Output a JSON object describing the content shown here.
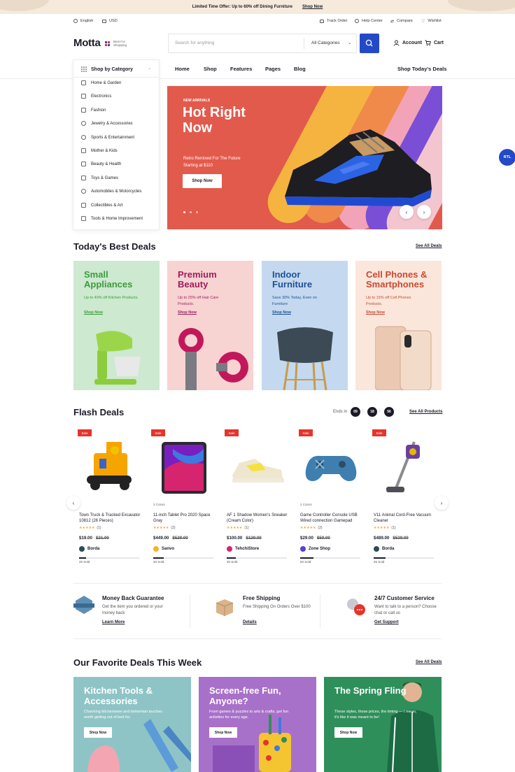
{
  "topbar": {
    "text": "Limited Time Offer: Up to 60% off Dining Furniture",
    "link": "Shop Now"
  },
  "utility": {
    "language": "English",
    "currency": "USD",
    "track": "Track Order",
    "help": "Help Center",
    "compare": "Compare",
    "wishlist": "Wishlist"
  },
  "header": {
    "logo": "Motta",
    "tagline": "Best For Shopping",
    "search_placeholder": "Search for anything",
    "category_select": "All Categories",
    "account": "Account",
    "cart": "Cart"
  },
  "nav": {
    "shop_by_category": "Shop by Category",
    "items": [
      "Home",
      "Shop",
      "Features",
      "Pages",
      "Blog"
    ],
    "right": "Shop Today's Deals"
  },
  "categories": [
    "Home & Garden",
    "Electronics",
    "Fashion",
    "Jewelry & Accessories",
    "Sports & Entertainment",
    "Mother & Kids",
    "Beauty & Health",
    "Toys & Games",
    "Automobiles & Motorcycles",
    "Collectibles & Art",
    "Tools & Home Improvement"
  ],
  "hero": {
    "kicker": "NEW ARRIVALS",
    "title": "Hot Right Now",
    "subtitle": "Retro Remixed For The Future Starting at $110",
    "button": "Shop Now",
    "rtl": "RTL"
  },
  "best_deals": {
    "title": "Today's Best Deals",
    "see_all": "See All Deals",
    "cards": [
      {
        "title": "Small Appliances",
        "desc": "Up to 40% off Kitchen Products.",
        "link": "Shop Now",
        "bg": "#cde9cf",
        "title_color": "#3d9a3e"
      },
      {
        "title": "Premium Beauty",
        "desc": "Up to 25% off Hair Care Products.",
        "link": "Shop Now",
        "bg": "#f7d3d1",
        "title_color": "#9d1d5d"
      },
      {
        "title": "Indoor Furniture",
        "desc": "Save 30% Today, Even on Furniture",
        "link": "Shop Now",
        "bg": "#c4d9ef",
        "title_color": "#1e4f98"
      },
      {
        "title": "Cell Phones & Smartphones",
        "desc": "Up to 15% off Cell Phones Products.",
        "link": "Shop Now",
        "bg": "#fbe6dc",
        "title_color": "#c9492f"
      }
    ]
  },
  "flash": {
    "title": "Flash Deals",
    "ends_in": "Ends in",
    "timer": [
      "09",
      "18",
      "56"
    ],
    "see_all": "See All Products",
    "sale_label": "Sale",
    "products": [
      {
        "colors": "",
        "name": "Town Truck & Tracked Excavator 10812 (26 Pieces)",
        "stars": "★★★★★",
        "reviews": "(1)",
        "price": "$19.00",
        "old": "$21.00",
        "store": "Borda",
        "store_color": "#2c4b56",
        "sold": "20 Sold",
        "sold_ratio": 0.12
      },
      {
        "colors": "3 Colors",
        "name": "11-inch Tablet Pro 2020 Space Gray",
        "stars": "★★★★★",
        "reviews": "(2)",
        "price": "$449.00",
        "old": "$529.00",
        "store": "Sanvo",
        "store_color": "#f0b429",
        "sold": "40 Sold",
        "sold_ratio": 0.18
      },
      {
        "colors": "",
        "name": "AF 1 Shadow Women's Sneaker (Cream Color)",
        "stars": "★★★★★",
        "reviews": "(1)",
        "price": "$100.00",
        "old": "$129.00",
        "store": "TehchiStore",
        "store_color": "#d6246e",
        "sold": "30 Sold",
        "sold_ratio": 0.15
      },
      {
        "colors": "2 Colors",
        "name": "Game Controller Console USB Wired connection Gamepad",
        "stars": "★★★★★",
        "reviews": "(2)",
        "price": "$29.00",
        "old": "$59.00",
        "store": "Zone Shop",
        "store_color": "#5b3fd6",
        "sold": "50 Sold",
        "sold_ratio": 0.22
      },
      {
        "colors": "",
        "name": "V11 Animal Cord-Free Vacuum Cleaner",
        "stars": "★★★★★",
        "reviews": "(1)",
        "price": "$489.00",
        "old": "$539.00",
        "store": "Borda",
        "store_color": "#2c4b56",
        "sold": "45 Sold",
        "sold_ratio": 0.2
      }
    ]
  },
  "services": [
    {
      "title": "Money Back Guarantee",
      "desc": "Get the item you ordered or your money back",
      "link": "Learn More"
    },
    {
      "title": "Free Shipping",
      "desc": "Free Shipping On Orders Over $100",
      "link": "Details"
    },
    {
      "title": "24/7 Customer Service",
      "desc": "Want to talk to a person? Choose chat or call us",
      "link": "Get Support"
    }
  ],
  "favorites": {
    "title": "Our Favorite Deals This Week",
    "see_all": "See All Deals",
    "cards": [
      {
        "title": "Kitchen Tools & Accessories",
        "desc": "Charming kitchenware and bohemian touches worth getting out of bed for.",
        "button": "Shop Now",
        "bg": "#8fc4c6"
      },
      {
        "title": "Screen-free Fun, Anyone?",
        "desc": "From games & puzzles to arts & crafts, get fun activities for every age.",
        "button": "Shop Now",
        "bg": "#a871c9"
      },
      {
        "title": "The Spring Fling",
        "desc": "These styles, those prices, the timing — I mean, it's like it was meant to be!",
        "button": "Shop Now",
        "bg": "#2f8f5b"
      }
    ]
  },
  "colors": {
    "accent": "#2449c8",
    "sale": "#e6342a",
    "hero": "#e25a4c"
  }
}
